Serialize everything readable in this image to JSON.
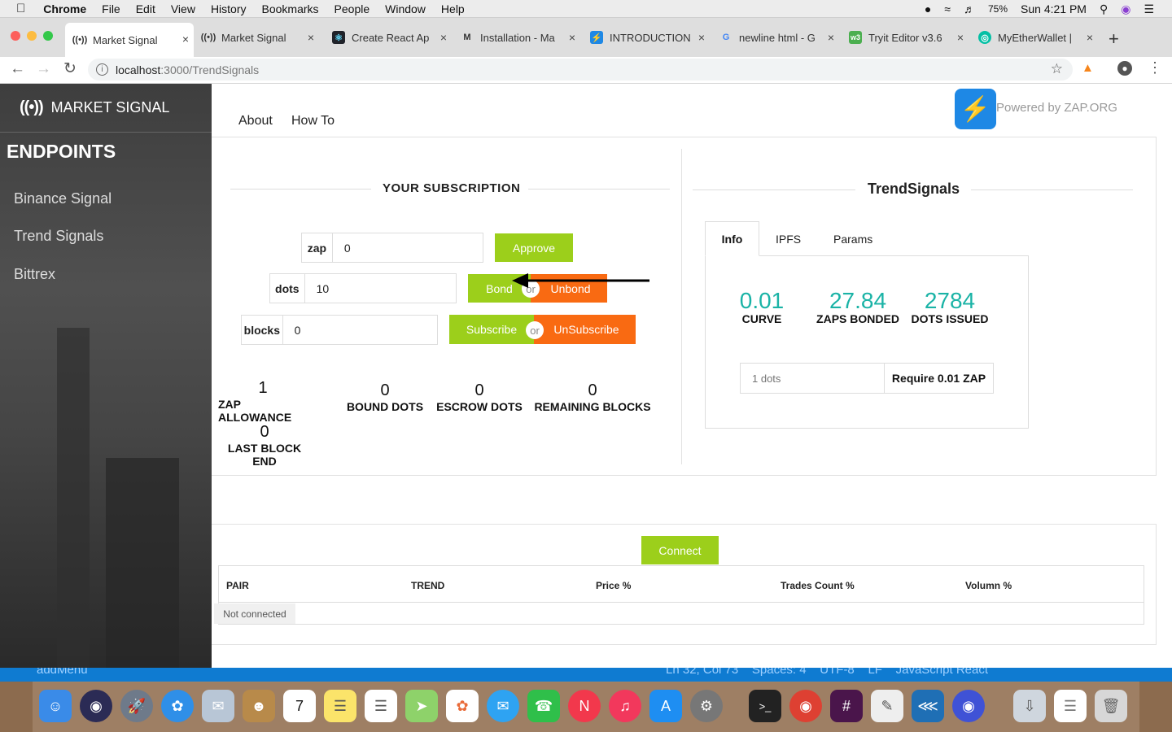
{
  "menubar": {
    "app": "Chrome",
    "items": [
      "File",
      "Edit",
      "View",
      "History",
      "Bookmarks",
      "People",
      "Window",
      "Help"
    ],
    "battery": "75%",
    "clock": "Sun 4:21 PM"
  },
  "tabs": [
    {
      "title": "Market Signal"
    },
    {
      "title": "Market Signal"
    },
    {
      "title": "Create React Ap"
    },
    {
      "title": "Installation - Ma"
    },
    {
      "title": "INTRODUCTION"
    },
    {
      "title": "newline html - G"
    },
    {
      "title": "Tryit Editor v3.6"
    },
    {
      "title": "MyEtherWallet |"
    }
  ],
  "omnibox": {
    "host": "localhost",
    "path": ":3000/TrendSignals"
  },
  "sidebar": {
    "brand": "MARKET SIGNAL",
    "heading": "ENDPOINTS",
    "items": [
      {
        "label": "Binance Signal"
      },
      {
        "label": "Trend Signals"
      },
      {
        "label": "Bittrex"
      }
    ]
  },
  "nav": {
    "about": "About",
    "howto": "How To",
    "powered": "Powered by ZAP.ORG"
  },
  "subscription": {
    "title": "YOUR SUBSCRIPTION",
    "zap_label": "zap",
    "zap_value": "0",
    "approve": "Approve",
    "dots_label": "dots",
    "dots_value": "10",
    "bond": "Bond",
    "unbond": "Unbond",
    "or": "or",
    "blocks_label": "blocks",
    "blocks_value": "0",
    "subscribe": "Subscribe",
    "unsubscribe": "UnSubscribe",
    "stats": [
      {
        "value": "1",
        "label": "ZAP ALLOWANCE"
      },
      {
        "value": "0",
        "label": "BOUND DOTS"
      },
      {
        "value": "0",
        "label": "ESCROW DOTS"
      },
      {
        "value": "0",
        "label": "REMAINING BLOCKS"
      },
      {
        "value": "0",
        "label": "LAST BLOCK END"
      }
    ]
  },
  "endpoint": {
    "title": "TrendSignals",
    "tabs": [
      {
        "label": "Info"
      },
      {
        "label": "IPFS"
      },
      {
        "label": "Params"
      }
    ],
    "metrics": [
      {
        "value": "0.01",
        "label": "CURVE"
      },
      {
        "value": "27.84",
        "label": "ZAPS BONDED"
      },
      {
        "value": "2784",
        "label": "DOTS ISSUED"
      }
    ],
    "dots_placeholder": "1 dots",
    "require": "Require 0.01 ZAP"
  },
  "connect": {
    "button": "Connect",
    "columns": [
      "PAIR",
      "TREND",
      "Price %",
      "Trades Count %",
      "Volumn %"
    ],
    "status": "Not connected"
  },
  "editor_status": {
    "left": "addMenu",
    "right": "Ln 32, Col 73    Spaces: 4    UTF-8    LF    JavaScript React"
  }
}
